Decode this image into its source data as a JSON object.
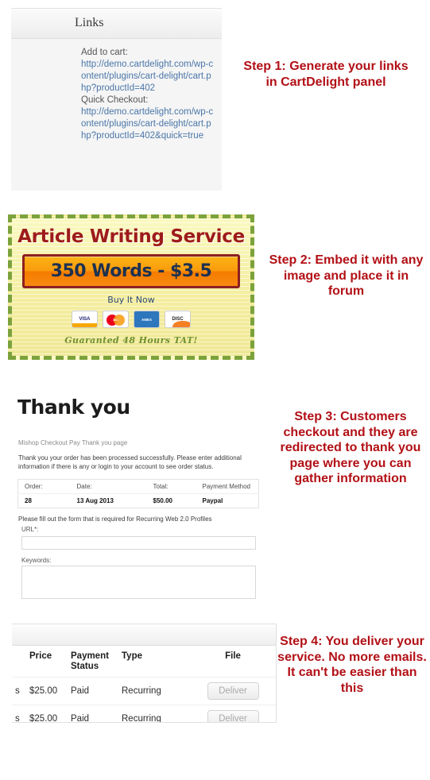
{
  "steps": [
    {
      "id": "step1",
      "text": "Step 1: Generate your links in CartDelight panel"
    },
    {
      "id": "step2",
      "text": "Step 2: Embed it with any image and place it in forum"
    },
    {
      "id": "step3",
      "text": "Step 3: Customers checkout and they are redirected to thank you page where you can gather information"
    },
    {
      "id": "step4",
      "text": "Step 4: You deliver your service. No more emails. It can't be easier than this"
    }
  ],
  "links_panel": {
    "header_title": "Links",
    "add_to_cart_label": "Add to cart:",
    "add_to_cart_url": "http://demo.cartdelight.com/wp-content/plugins/cart-delight/cart.php?productId=402",
    "quick_checkout_label": "Quick Checkout:",
    "quick_checkout_url": "http://demo.cartdelight.com/wp-content/plugins/cart-delight/cart.php?productId=402&quick=true"
  },
  "banner": {
    "title": "Article Writing Service",
    "cta": "350 Words - $3.5",
    "buy_now": "Buy It Now",
    "guarantee": "Guaranted 48 Hours TAT!",
    "cards": [
      {
        "name": "visa-card-icon",
        "label": "VISA"
      },
      {
        "name": "mastercard-card-icon",
        "label": "MasterCard"
      },
      {
        "name": "amex-card-icon",
        "label": "AMERICAN EXPRESS"
      },
      {
        "name": "discover-card-icon",
        "label": "DISCOVER"
      }
    ],
    "border_color": "#7ca23c",
    "cta_color": "#f79100",
    "title_color": "#9e1b1b"
  },
  "thank_you": {
    "title": "Thank you",
    "subtitle": "Mishop Checkout Pay Thank you page",
    "body": "Thank you your order has been processed successfully. Please enter additional information if there is any or login to your account to see order status.",
    "order_table": {
      "headers": [
        "Order:",
        "Date:",
        "Total:",
        "Payment Method"
      ],
      "row": [
        "28",
        "13 Aug 2013",
        "$50.00",
        "Paypal"
      ]
    },
    "form_lead": "Please fill out the form that is required for Recurring Web 2.0 Profiles",
    "url_label": "URL*:",
    "url_value": "",
    "keywords_label": "Keywords:",
    "keywords_value": ""
  },
  "deliver_table": {
    "headers": [
      "",
      "Price",
      "Payment Status",
      "Type",
      "File"
    ],
    "rows": [
      {
        "trunc": "s",
        "price": "$25.00",
        "status": "Paid",
        "type": "Recurring",
        "file": "Deliver"
      },
      {
        "trunc": "s",
        "price": "$25.00",
        "status": "Paid",
        "type": "Recurring",
        "file": "Deliver"
      }
    ]
  },
  "colors": {
    "step_red": "#b21016",
    "link_blue": "#4a76a8"
  }
}
